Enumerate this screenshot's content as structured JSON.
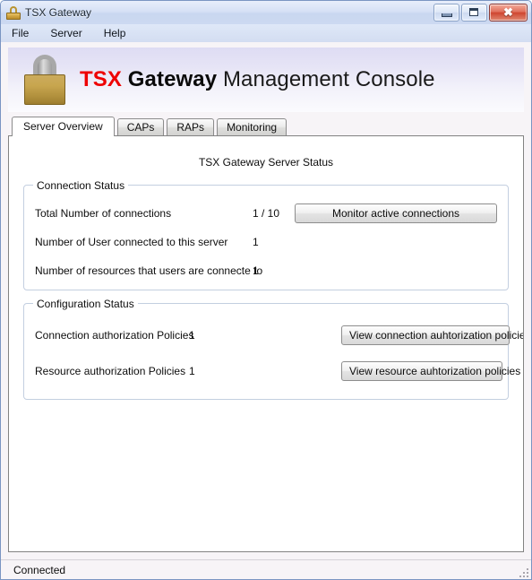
{
  "window": {
    "title": "TSX Gateway",
    "icon": "padlock-icon",
    "minimize_label": "Minimize",
    "maximize_label": "Maximize",
    "close_label": "✖"
  },
  "menubar": {
    "items": [
      {
        "label": "File"
      },
      {
        "label": "Server"
      },
      {
        "label": "Help"
      }
    ]
  },
  "banner": {
    "icon": "padlock-icon",
    "brand": "TSX",
    "product": "Gateway",
    "suffix": "Management Console",
    "brand_color": "#ee0000"
  },
  "tabs": [
    {
      "label": "Server Overview",
      "active": true
    },
    {
      "label": "CAPs",
      "active": false
    },
    {
      "label": "RAPs",
      "active": false
    },
    {
      "label": "Monitoring",
      "active": false
    }
  ],
  "overview": {
    "heading": "TSX Gateway Server Status",
    "connection_status": {
      "title": "Connection Status",
      "rows": [
        {
          "label": "Total Number of connections",
          "value": "1 / 10"
        },
        {
          "label": "Number of User connected to this server",
          "value": "1"
        },
        {
          "label": "Number of resources that users are connecte to",
          "value": "1"
        }
      ],
      "monitor_button": "Monitor active connections"
    },
    "configuration_status": {
      "title": "Configuration Status",
      "rows": [
        {
          "label": "Connection authorization Policies",
          "value": "1",
          "button": "View connection auhtorization policies"
        },
        {
          "label": "Resource authorization Policies",
          "value": "1",
          "button": "View resource auhtorization policies"
        }
      ]
    }
  },
  "statusbar": {
    "text": "Connected"
  }
}
